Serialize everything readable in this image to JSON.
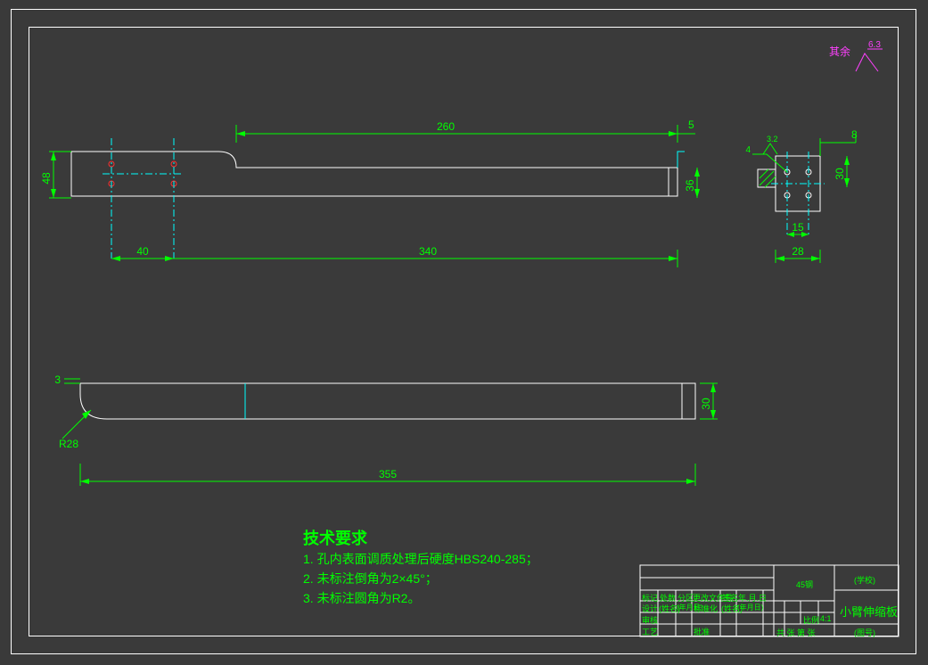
{
  "dims": {
    "d260": "260",
    "d5": "5",
    "d8": "8",
    "d48": "48",
    "d40": "40",
    "d30v": "30",
    "d36": "36",
    "d15": "15",
    "d28": "28",
    "d340": "340",
    "d30bottom": "30",
    "d355": "355",
    "d3": "3",
    "r28": "R28",
    "ra63": "6.3",
    "ra32": "3.2",
    "holedia": "4"
  },
  "tech": {
    "heading": "技术要求",
    "l1": "1. 孔内表面调质处理后硬度HBS240-285；",
    "l2": "2. 未标注倒角为2×45°；",
    "l3": "3. 未标注圆角为R2。"
  },
  "tb": {
    "material": "45钢",
    "scale_label": "比例",
    "scale": "4:1",
    "school": "(学校)",
    "partname": "小臂伸缩板",
    "partno": "(图号)",
    "sheets": "共  张    第  张",
    "r1c1": "标记",
    "r1c2": "处数",
    "r1c3": "分区",
    "r1c4": "更改文件号",
    "r1c5": "签名",
    "r1c6": "年.月.日",
    "r2c1": "设计",
    "r2c2": "(姓名)",
    "r2c3": "(年月日)",
    "r2c4": "标准化",
    "r2c5": "(姓名)",
    "r2c6": "(年月日)",
    "r3c1": "审核",
    "r4c1": "工艺",
    "r4c2": "批准"
  },
  "marks": {
    "other": "其余"
  }
}
